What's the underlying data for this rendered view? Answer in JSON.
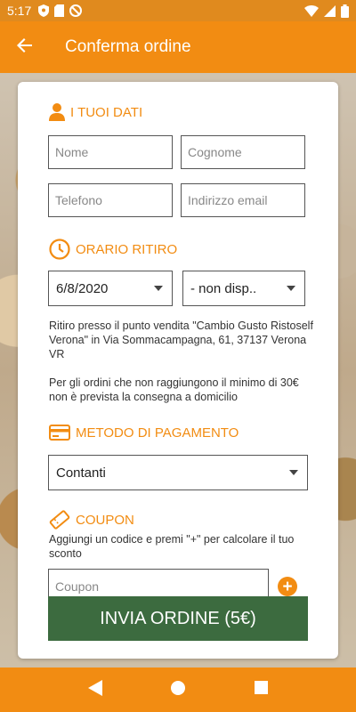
{
  "status_bar": {
    "time": "5:17"
  },
  "app_bar": {
    "title": "Conferma ordine"
  },
  "personal": {
    "heading": "I TUOI DATI",
    "nome_placeholder": "Nome",
    "cognome_placeholder": "Cognome",
    "telefono_placeholder": "Telefono",
    "email_placeholder": "Indirizzo email"
  },
  "pickup": {
    "heading": "ORARIO RITIRO",
    "date_value": "6/8/2020",
    "time_value": "- non disp..",
    "address_text": "Ritiro presso il punto vendita \"Cambio Gusto Ristoself Verona\" in Via Sommacampagna, 61, 37137 Verona VR",
    "minimum_text": "Per gli ordini che non raggiungono il minimo di 30€ non è prevista la consegna a domicilio"
  },
  "payment": {
    "heading": "METODO DI PAGAMENTO",
    "method_value": "Contanti"
  },
  "coupon": {
    "heading": "COUPON",
    "help_text": "Aggiungi un codice e premi \"+\" per calcolare il tuo sconto",
    "placeholder": "Coupon",
    "add_symbol": "+"
  },
  "submit": {
    "label": "INVIA ORDINE (5€)"
  },
  "colors": {
    "accent": "#f28c12",
    "submit_bg": "#3c6b3f"
  }
}
